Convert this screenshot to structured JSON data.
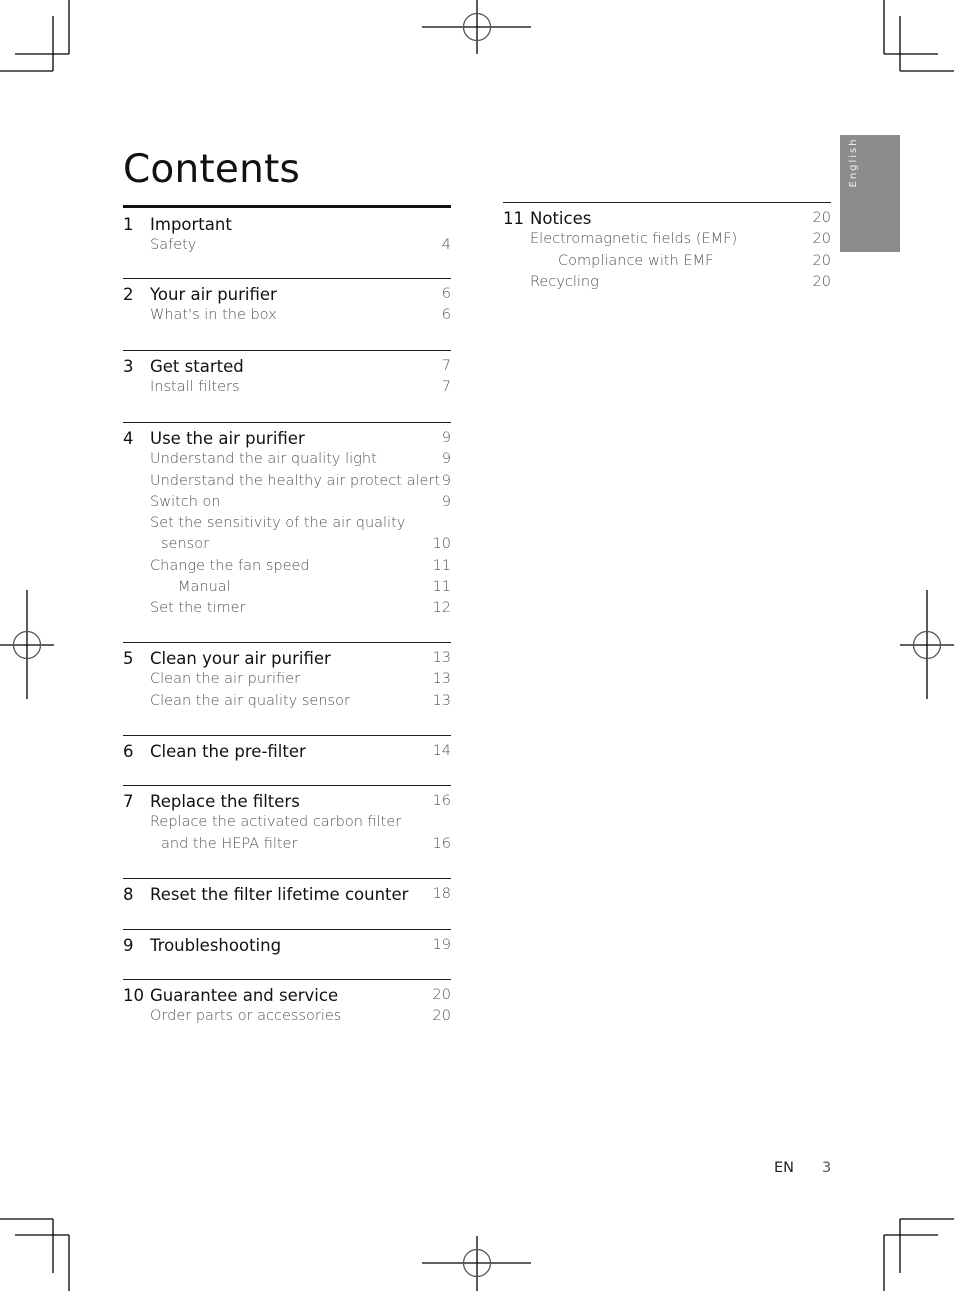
{
  "page": {
    "title": "Contents",
    "language_tab": "English",
    "footer": {
      "lang": "EN",
      "page_number": "3"
    }
  },
  "toc_left": [
    {
      "num": "1",
      "title": "Important",
      "page": "",
      "entries": [
        {
          "label": "Safety",
          "page": "4",
          "indent": 0
        }
      ]
    },
    {
      "num": "2",
      "title": "Your air purifier",
      "page": "6",
      "entries": [
        {
          "label": "What's in the box",
          "page": "6",
          "indent": 0
        }
      ]
    },
    {
      "num": "3",
      "title": "Get started",
      "page": "7",
      "entries": [
        {
          "label": "Install filters",
          "page": "7",
          "indent": 0
        }
      ]
    },
    {
      "num": "4",
      "title": "Use the air purifier",
      "page": "9",
      "entries": [
        {
          "label": "Understand the air quality light",
          "page": "9",
          "indent": 0
        },
        {
          "label": "Understand the healthy air protect alert",
          "page": "9",
          "indent": 0
        },
        {
          "label": "Switch on",
          "page": "9",
          "indent": 0
        },
        {
          "label": "Set the sensitivity of the air quality",
          "page": "",
          "indent": 0
        },
        {
          "label": "sensor",
          "page": "10",
          "indent": 1
        },
        {
          "label": "Change the fan speed",
          "page": "11",
          "indent": 0
        },
        {
          "label": "Manual",
          "page": "11",
          "indent": 2
        },
        {
          "label": "Set the timer",
          "page": "12",
          "indent": 0
        }
      ]
    },
    {
      "num": "5",
      "title": "Clean your air purifier",
      "page": "13",
      "entries": [
        {
          "label": "Clean the air purifier",
          "page": "13",
          "indent": 0
        },
        {
          "label": "Clean the air quality sensor",
          "page": "13",
          "indent": 0
        }
      ]
    },
    {
      "num": "6",
      "title": "Clean the pre-filter",
      "page": "14",
      "entries": []
    },
    {
      "num": "7",
      "title": "Replace the filters",
      "page": "16",
      "entries": [
        {
          "label": "Replace the activated carbon filter",
          "page": "",
          "indent": 0
        },
        {
          "label": "and the HEPA filter",
          "page": "16",
          "indent": 1
        }
      ]
    },
    {
      "num": "8",
      "title": "Reset the filter lifetime counter",
      "page": "18",
      "entries": []
    },
    {
      "num": "9",
      "title": "Troubleshooting",
      "page": "19",
      "entries": []
    },
    {
      "num": "10",
      "title": "Guarantee and service",
      "page": "20",
      "entries": [
        {
          "label": "Order parts or accessories",
          "page": "20",
          "indent": 0
        }
      ]
    }
  ],
  "toc_right": [
    {
      "num": "11",
      "title": "Notices",
      "page": "20",
      "entries": [
        {
          "label": "Electromagnetic fields (EMF)",
          "page": "20",
          "indent": 0
        },
        {
          "label": "Compliance with EMF",
          "page": "20",
          "indent": 2
        },
        {
          "label": "Recycling",
          "page": "20",
          "indent": 0
        }
      ]
    }
  ]
}
